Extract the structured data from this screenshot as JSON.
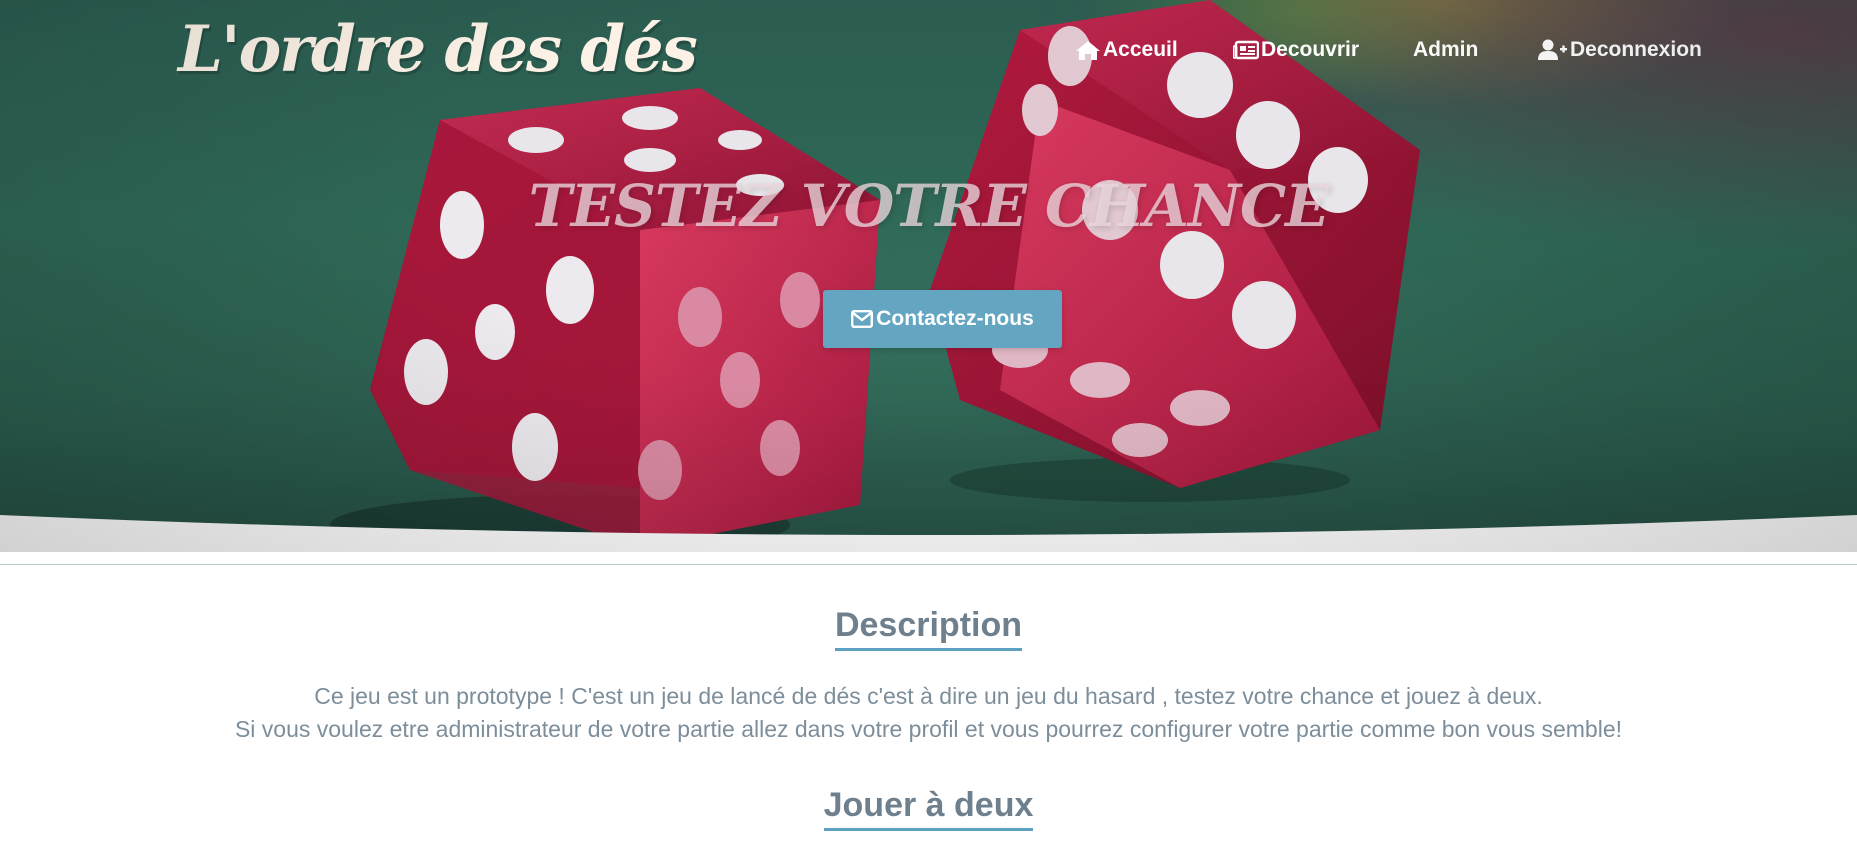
{
  "brand": {
    "title": "L'ordre des dés"
  },
  "nav": {
    "items": [
      {
        "label": "Acceuil",
        "icon": "home-icon"
      },
      {
        "label": "Decouvrir",
        "icon": "newspaper-icon"
      },
      {
        "label": "Admin",
        "icon": ""
      },
      {
        "label": "Deconnexion",
        "icon": "user-plus-icon"
      }
    ]
  },
  "hero": {
    "title": "TESTEZ VOTRE CHANCE",
    "cta_label": "Contactez-nous",
    "cta_icon": "envelope-icon",
    "image": "red-dice-on-green-felt"
  },
  "sections": {
    "description": {
      "title": "Description",
      "line1": "Ce jeu est un prototype ! C'est un jeu de lancé de dés c'est à dire un jeu du hasard , testez votre chance et jouez à deux.",
      "line2": "Si vous voulez etre administrateur de votre partie allez dans votre profil et vous pourrez configurer votre partie comme bon vous semble!"
    },
    "play": {
      "title": "Jouer à deux"
    }
  },
  "colors": {
    "felt": "#2f6a58",
    "dice": "#c8224a",
    "cta": "#64a6c2",
    "heading": "#6e7f8d",
    "underline": "#5da0bf",
    "body_text": "#7d8e9b"
  }
}
